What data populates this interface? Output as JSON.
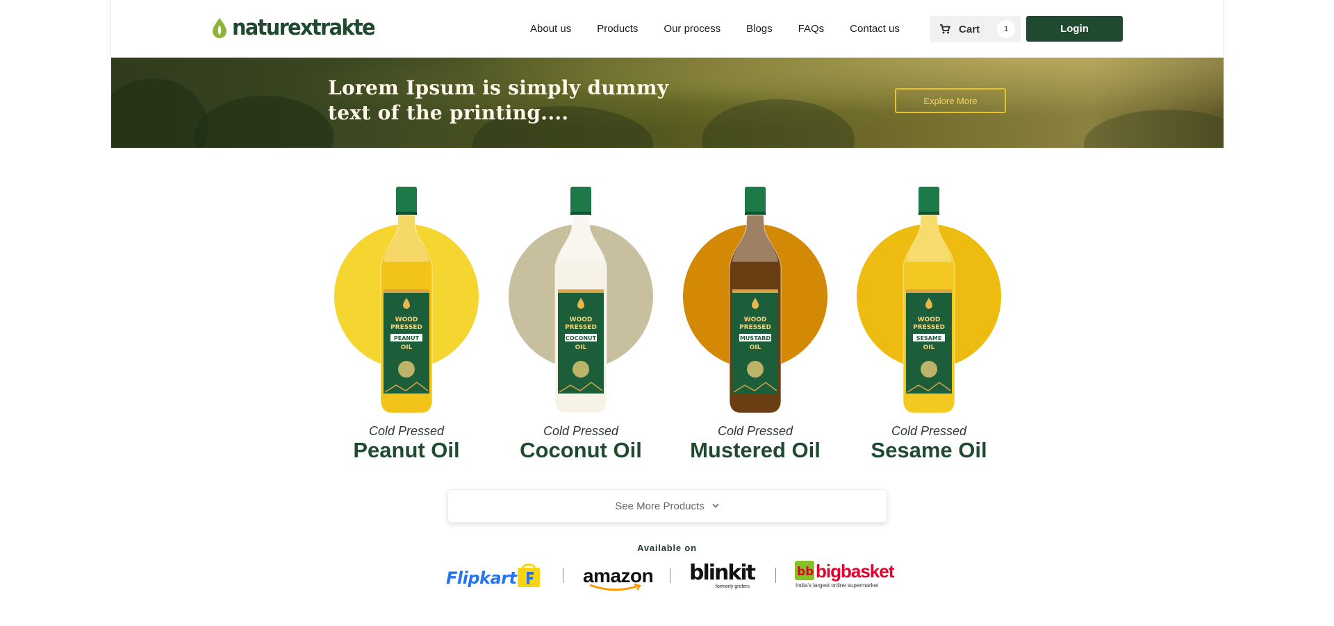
{
  "header": {
    "brand": "naturextrakte",
    "nav": [
      "About us",
      "Products",
      "Our process",
      "Blogs",
      "FAQs",
      "Contact us"
    ],
    "cart_label": "Cart",
    "cart_count": "1",
    "login_label": "Login"
  },
  "banner": {
    "title_line1": "Lorem Ipsum is simply dummy",
    "title_line2": "text of the printing....",
    "cta": "Explore More"
  },
  "products": [
    {
      "subtitle": "Cold Pressed",
      "name": "Peanut Oil",
      "label_word": "PEANUT",
      "circle_color": "#f5d530",
      "oil_color": "#f2c318",
      "cap_color": "#1d7a48"
    },
    {
      "subtitle": "Cold Pressed",
      "name": "Coconut Oil",
      "label_word": "COCONUT",
      "circle_color": "#c8bf9f",
      "oil_color": "#f6f2e6",
      "cap_color": "#1d7a48"
    },
    {
      "subtitle": "Cold Pressed",
      "name": "Mustered Oil",
      "label_word": "MUSTARD",
      "circle_color": "#d38806",
      "oil_color": "#6b3d12",
      "cap_color": "#1d7a48"
    },
    {
      "subtitle": "Cold Pressed",
      "name": "Sesame Oil",
      "label_word": "SESAME",
      "circle_color": "#eebc10",
      "oil_color": "#f3c820",
      "cap_color": "#1d7a48"
    }
  ],
  "bottle_label": {
    "line1": "WOOD",
    "line2": "PRESSED",
    "line3": "OIL"
  },
  "see_more": "See More Products",
  "available_on": "Available on",
  "partners": {
    "flipkart": "Flipkart",
    "amazon": "amazon",
    "blinkit": "blinkit",
    "blinkit_sub": "formerly grofers",
    "bigbasket": "bigbasket",
    "bigbasket_sub": "India's largest online supermarket"
  },
  "colors": {
    "brand_green": "#1f4a30",
    "accent_gold": "#e7c42c"
  }
}
